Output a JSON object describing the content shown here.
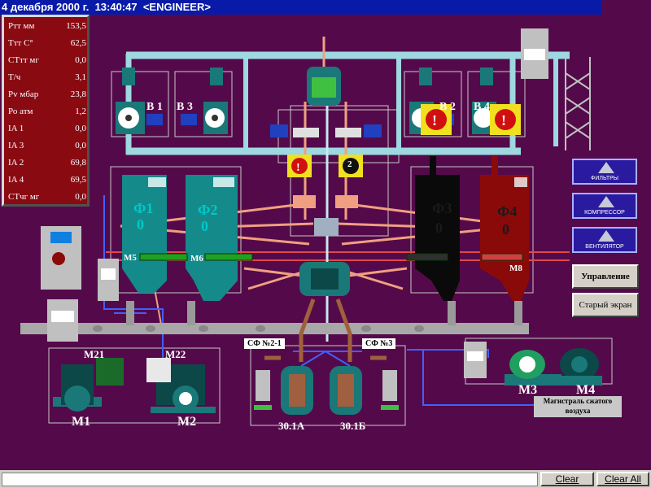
{
  "title": {
    "date": "4 декабря 2000 г.",
    "time": "13:40:47",
    "user": "<ENGINEER>"
  },
  "params": [
    {
      "label": "Ртт мм",
      "value": "153,5"
    },
    {
      "label": "Ттт С°",
      "value": "62,5"
    },
    {
      "label": "СТтт мг",
      "value": "0,0"
    },
    {
      "label": "Т/ч",
      "value": "3,1"
    },
    {
      "label": "Рv мбар",
      "value": "23,8"
    },
    {
      "label": "Ро атм",
      "value": "1,2"
    },
    {
      "label": "IA 1",
      "value": "0,0"
    },
    {
      "label": "IA 3",
      "value": "0,0"
    },
    {
      "label": "IA 2",
      "value": "69,8"
    },
    {
      "label": "IA 4",
      "value": "69,5"
    },
    {
      "label": "СТчг мг",
      "value": "0,0"
    }
  ],
  "fans": {
    "b1": "В 1",
    "b3": "В 3",
    "b2": "В 2",
    "b4": "В 4"
  },
  "filters": [
    {
      "name": "Ф1",
      "level": "0",
      "color": "#148a8a"
    },
    {
      "name": "Ф2",
      "level": "0",
      "color": "#148a8a"
    },
    {
      "name": "Ф3",
      "level": "0",
      "color": "#0a0a0a"
    },
    {
      "name": "Ф4",
      "level": "0",
      "color": "#8a0a0a"
    }
  ],
  "motors": {
    "m5": "М5",
    "m6": "М6",
    "m8": "М8",
    "m21": "М21",
    "m22": "М22",
    "m1": "М1",
    "m2": "М2",
    "m3": "М3",
    "m4": "М4"
  },
  "alarm_badge": "2",
  "separators": {
    "sf1": "СФ №2-1",
    "sf3": "СФ №3",
    "a": "30.1А",
    "b": "30.1Б"
  },
  "air_line": "Магистраль сжатого воздуха",
  "side_buttons": {
    "filters": "ФИЛЬТРЫ",
    "compressor": "КОМПРЕССОР",
    "fan": "ВЕНТИЛЯТОР"
  },
  "control_button": "Управление",
  "old_screen_button": "Старый экран",
  "clear_button": "Clear",
  "clear_all_button": "Clear All",
  "colors": {
    "background": "#540a4a",
    "titlebar": "#0a1aa8",
    "pipe_light": "#9ed8e0",
    "pipe_salmon": "#f0a080",
    "pipe_red": "#e04848",
    "equipment_teal": "#1a7878",
    "alarm_yellow": "#f0e020"
  }
}
